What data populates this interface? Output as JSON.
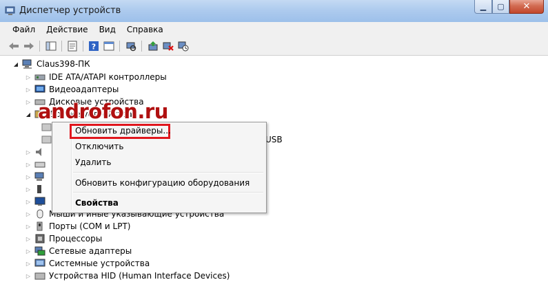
{
  "window": {
    "title": "Диспетчер устройств"
  },
  "menubar": [
    "Файл",
    "Действие",
    "Вид",
    "Справка"
  ],
  "tree": {
    "root": "Claus398-ПК",
    "items": [
      {
        "label": "IDE ATA/ATAPI контроллеры",
        "expanded": false
      },
      {
        "label": "Видеоадаптеры",
        "expanded": false
      },
      {
        "label": "Дисковые устройства",
        "expanded": false
      },
      {
        "label": "Другие устройства",
        "expanded": true
      },
      {
        "label": "USB",
        "expanded": false
      },
      {
        "label": "Мыши и иные указывающие устройства",
        "expanded": false
      },
      {
        "label": "Порты (COM и LPT)",
        "expanded": false
      },
      {
        "label": "Процессоры",
        "expanded": false
      },
      {
        "label": "Сетевые адаптеры",
        "expanded": false
      },
      {
        "label": "Системные устройства",
        "expanded": false
      },
      {
        "label": "Устройства HID (Human Interface Devices)",
        "expanded": false
      }
    ]
  },
  "watermark": "androfon.ru",
  "context_menu": {
    "update_drivers": "Обновить драйверы...",
    "disable": "Отключить",
    "uninstall": "Удалить",
    "scan_hardware": "Обновить конфигурацию оборудования",
    "properties": "Свойства"
  },
  "colors": {
    "highlight_box": "#e0161d",
    "watermark": "#b01010"
  }
}
